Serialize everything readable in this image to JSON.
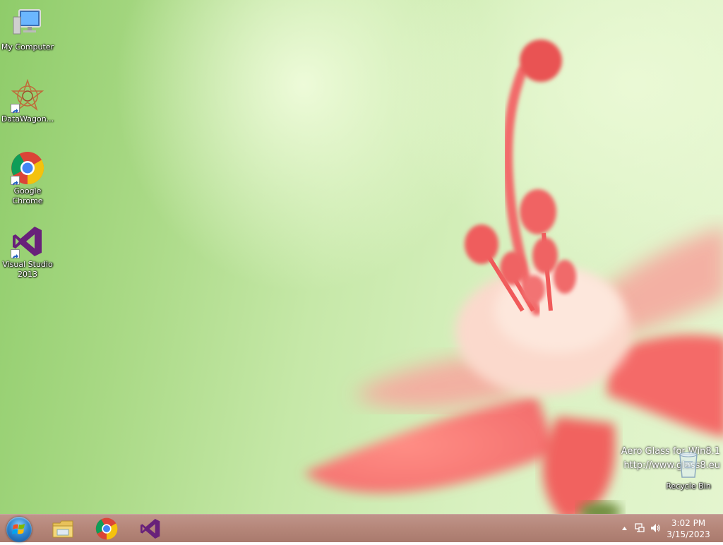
{
  "desktop": {
    "icons": [
      {
        "label": "My Computer",
        "icon": "computer-icon"
      },
      {
        "label": "DataWagon...",
        "icon": "datawagon-icon"
      },
      {
        "label": "Google\nChrome",
        "icon": "chrome-icon"
      },
      {
        "label": "Visual Studio\n2013",
        "icon": "visual-studio-icon"
      }
    ],
    "recycle_bin": {
      "label": "Recycle Bin",
      "icon": "recycle-bin-icon"
    },
    "watermark": {
      "line1": "Aero Glass for Win8.1",
      "line2": "http://www.glass8.eu"
    }
  },
  "taskbar": {
    "start": {
      "icon": "windows-start-icon"
    },
    "pinned": [
      {
        "name": "File Explorer",
        "icon": "folder-icon"
      },
      {
        "name": "Google Chrome",
        "icon": "chrome-icon"
      },
      {
        "name": "Visual Studio",
        "icon": "visual-studio-icon"
      }
    ],
    "tray": {
      "icons": [
        "show-hidden-icons-icon",
        "network-icon",
        "volume-icon"
      ],
      "time": "3:02 PM",
      "date": "3/15/2023"
    }
  },
  "colors": {
    "taskbar": "#b58679",
    "wallpaper_green": "#a9d985",
    "flower_pink": "#f26b6b"
  }
}
